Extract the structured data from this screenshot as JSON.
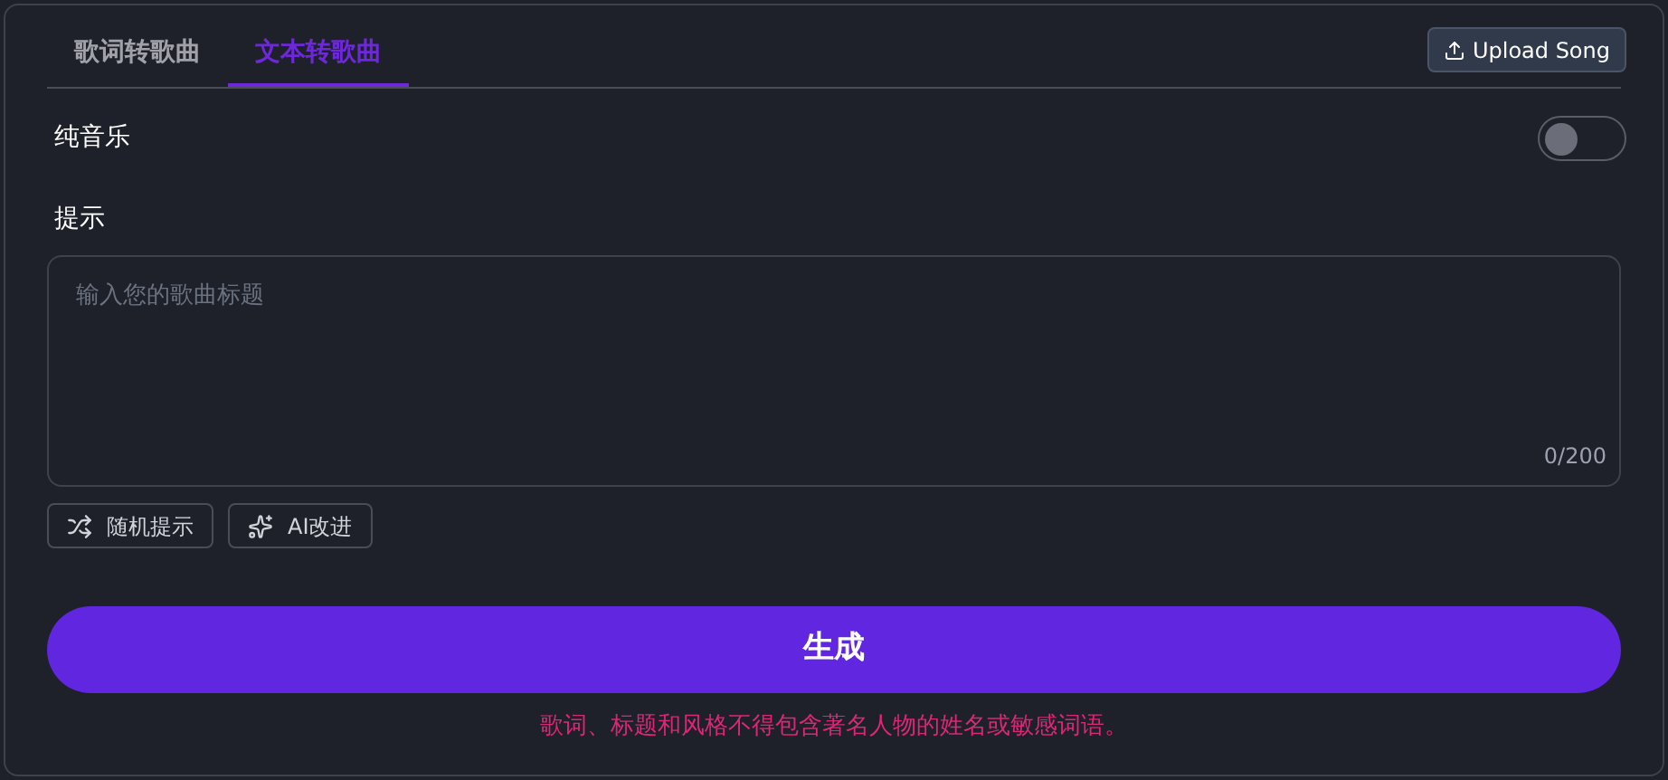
{
  "tabs": [
    {
      "label": "歌词转歌曲",
      "selected": false
    },
    {
      "label": "文本转歌曲",
      "selected": true
    }
  ],
  "upload_button": "Upload Song",
  "instrumental": {
    "label": "纯音乐",
    "on": false
  },
  "prompt": {
    "label": "提示",
    "placeholder": "输入您的歌曲标题",
    "counter": "0/200"
  },
  "prompt_actions": [
    {
      "label": "随机提示",
      "kind": "shuffle"
    },
    {
      "label": "AI改进",
      "kind": "sparkle"
    }
  ],
  "generate_button": "生成",
  "notice": "歌词、标题和风格不得包含著名人物的姓名或敏感词语。"
}
